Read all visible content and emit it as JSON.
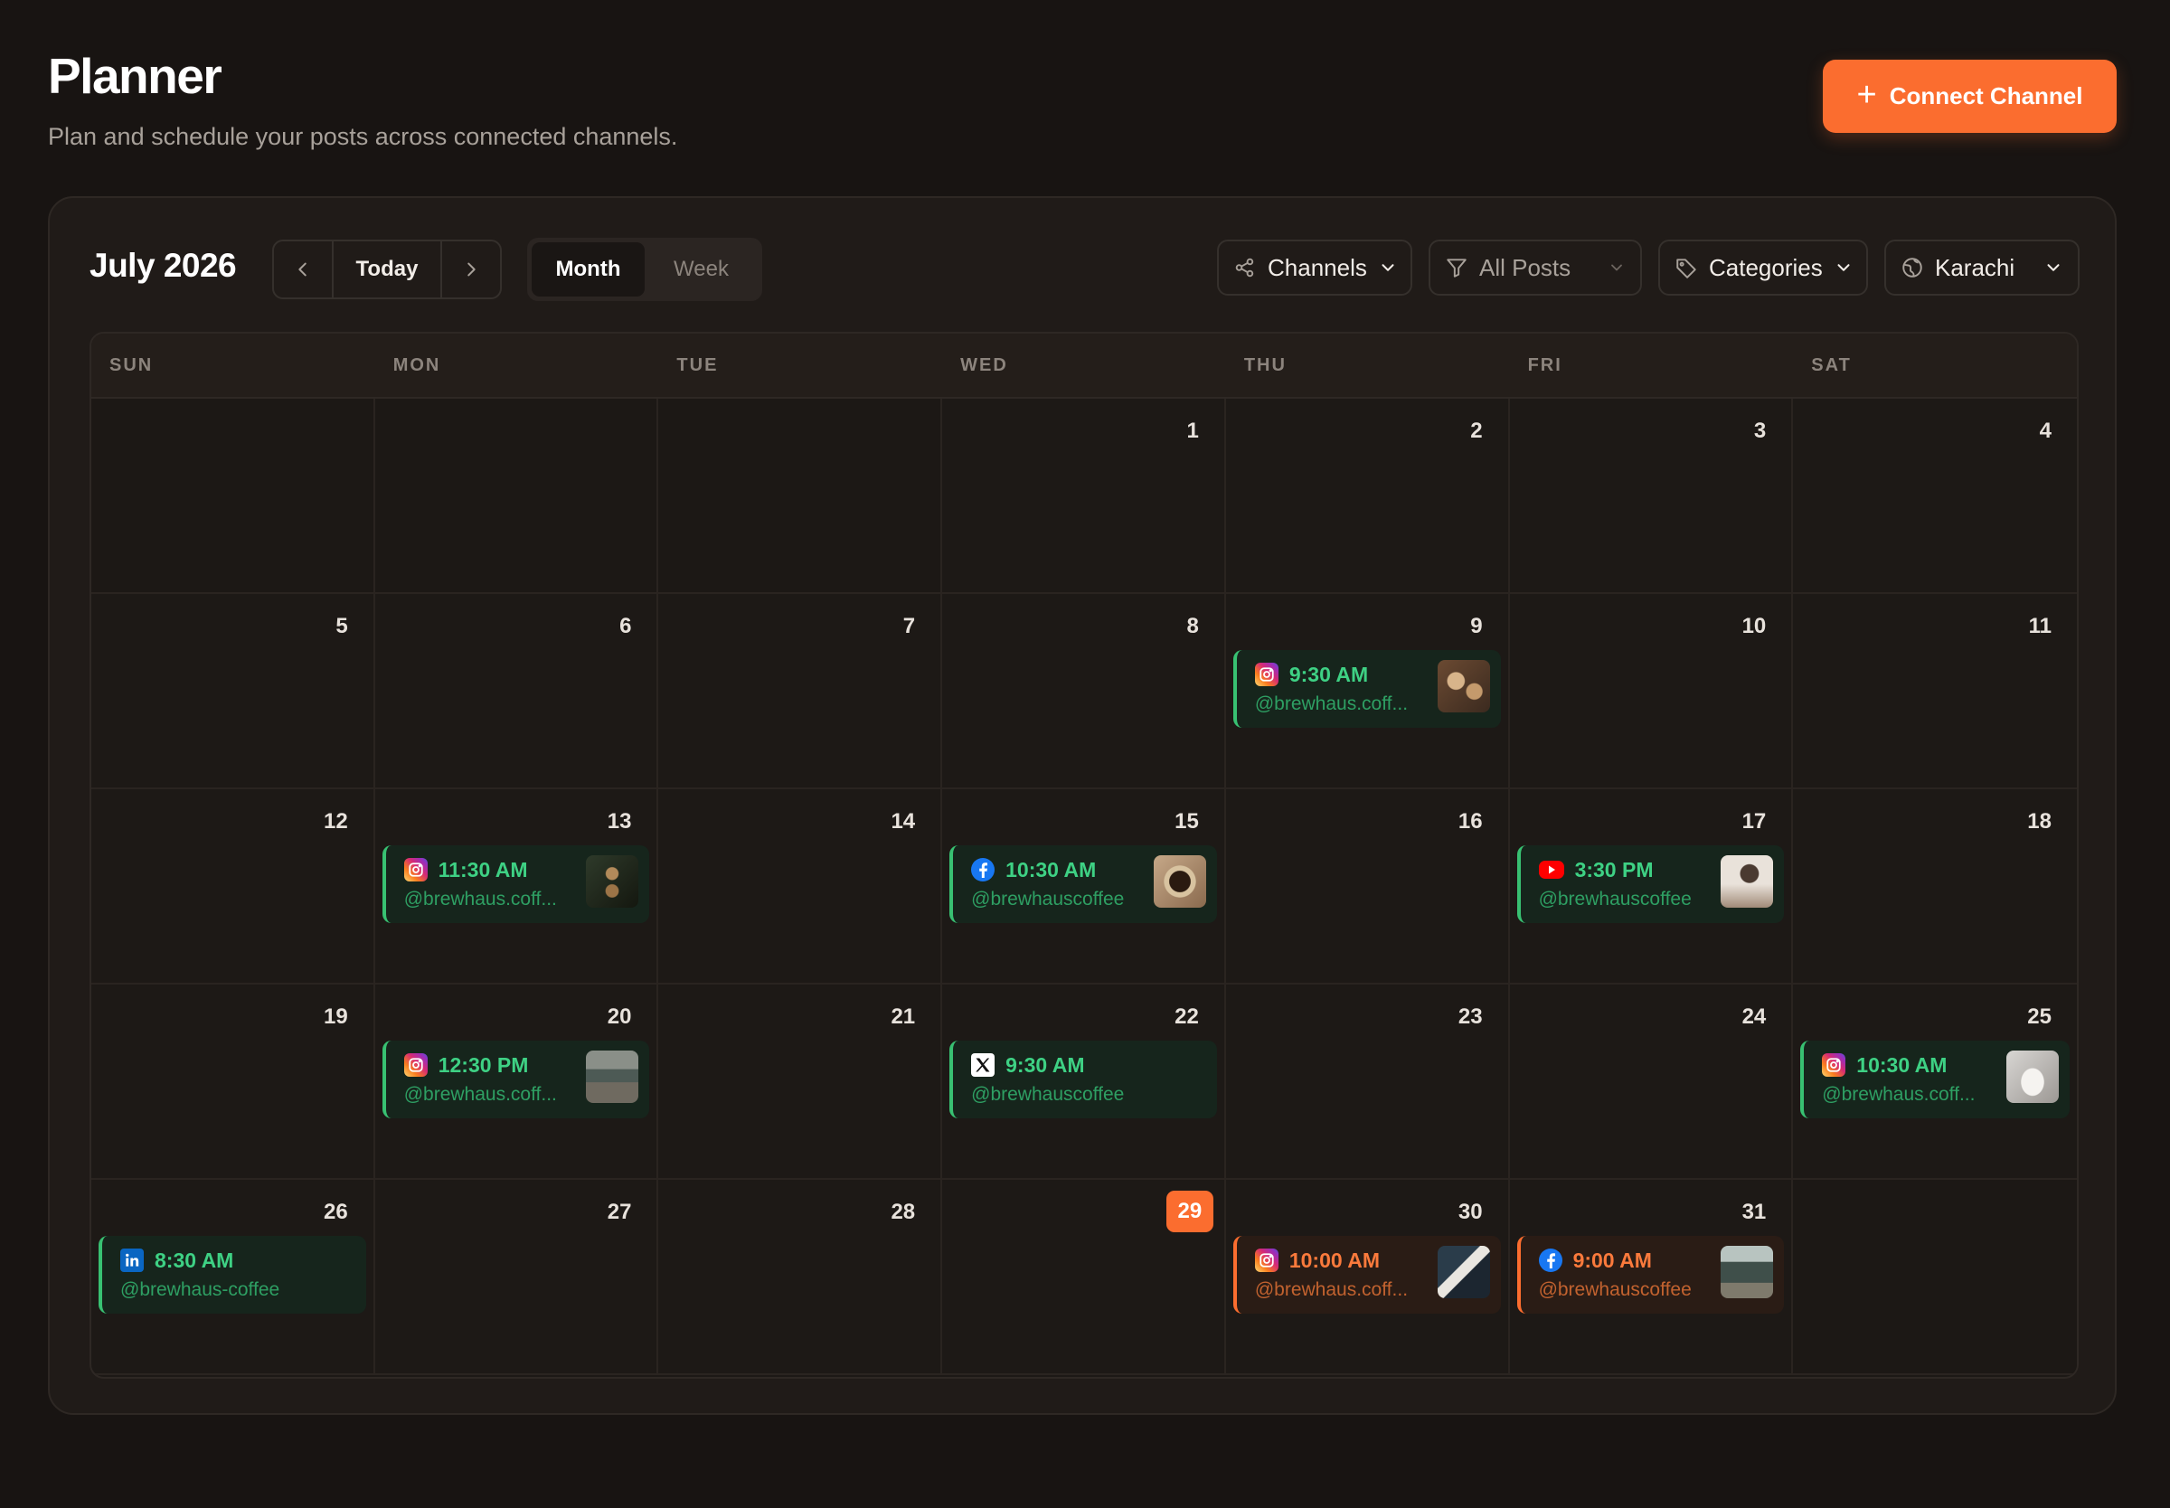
{
  "header": {
    "title": "Planner",
    "subtitle": "Plan and schedule your posts across connected channels.",
    "connect_label": "Connect Channel"
  },
  "toolbar": {
    "month_label": "July 2026",
    "today_label": "Today",
    "views": [
      "Month",
      "Week"
    ],
    "active_view": "Month",
    "filters": {
      "channels": "Channels",
      "posts": "All Posts",
      "categories": "Categories",
      "timezone": "Karachi"
    }
  },
  "weekdays": [
    "SUN",
    "MON",
    "TUE",
    "WED",
    "THU",
    "FRI",
    "SAT"
  ],
  "today": "29",
  "days": [
    "",
    "",
    "",
    "1",
    "2",
    "3",
    "4",
    "5",
    "6",
    "7",
    "8",
    "9",
    "10",
    "11",
    "12",
    "13",
    "14",
    "15",
    "16",
    "17",
    "18",
    "19",
    "20",
    "21",
    "22",
    "23",
    "24",
    "25",
    "26",
    "27",
    "28",
    "29",
    "30",
    "31",
    ""
  ],
  "posts": [
    {
      "day": "9",
      "platform": "instagram",
      "time": "9:30 AM",
      "handle": "@brewhaus.coff...",
      "status": "scheduled",
      "thumb": true
    },
    {
      "day": "13",
      "platform": "instagram",
      "time": "11:30 AM",
      "handle": "@brewhaus.coff...",
      "status": "scheduled",
      "thumb": true
    },
    {
      "day": "15",
      "platform": "facebook",
      "time": "10:30 AM",
      "handle": "@brewhauscoffee",
      "status": "scheduled",
      "thumb": true
    },
    {
      "day": "17",
      "platform": "youtube",
      "time": "3:30 PM",
      "handle": "@brewhauscoffee",
      "status": "scheduled",
      "thumb": true
    },
    {
      "day": "20",
      "platform": "instagram",
      "time": "12:30 PM",
      "handle": "@brewhaus.coff...",
      "status": "scheduled",
      "thumb": true
    },
    {
      "day": "22",
      "platform": "x",
      "time": "9:30 AM",
      "handle": "@brewhauscoffee",
      "status": "scheduled",
      "thumb": false
    },
    {
      "day": "25",
      "platform": "instagram",
      "time": "10:30 AM",
      "handle": "@brewhaus.coff...",
      "status": "scheduled",
      "thumb": true
    },
    {
      "day": "26",
      "platform": "linkedin",
      "time": "8:30 AM",
      "handle": "@brewhaus-coffee",
      "status": "scheduled",
      "thumb": false
    },
    {
      "day": "30",
      "platform": "instagram",
      "time": "10:00 AM",
      "handle": "@brewhaus.coff...",
      "status": "pending",
      "thumb": true
    },
    {
      "day": "31",
      "platform": "facebook",
      "time": "9:00 AM",
      "handle": "@brewhauscoffee",
      "status": "pending",
      "thumb": true
    }
  ],
  "colors": {
    "accent": "#fb6d2f",
    "scheduled": "#3ed184",
    "pending": "#fb7a3c",
    "background": "#181412"
  }
}
